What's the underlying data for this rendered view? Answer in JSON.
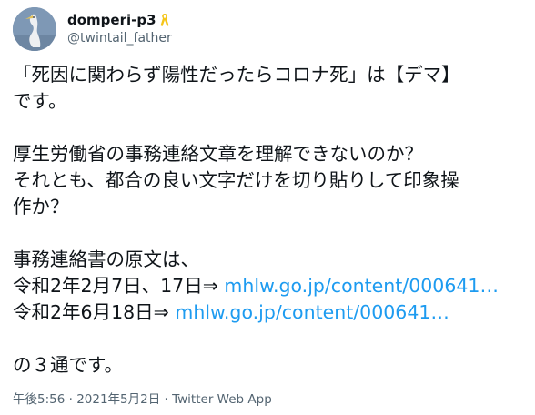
{
  "author": {
    "display_name": "domperi-p3",
    "handle": "@twintail_father",
    "badge_icon": "yellow-ribbon-icon"
  },
  "tweet": {
    "paragraph1": {
      "line1": "「死因に関わらず陽性だったらコロナ死」は【デマ】",
      "line2": "です。"
    },
    "paragraph2": {
      "line1": "厚生労働省の事務連絡文章を理解できないのか？",
      "line2": "それとも、都合の良い文字だけを切り貼りして印象操",
      "line3": "作か？"
    },
    "paragraph3": {
      "intro": "事務連絡書の原文は、",
      "item1_prefix": "令和2年2月7日、17日⇒ ",
      "item1_link": "mhlw.go.jp/content/000641…",
      "item2_prefix": "令和2年6月18日⇒ ",
      "item2_link": "mhlw.go.jp/content/000641…"
    },
    "closing": "の３通です。"
  },
  "meta": {
    "time": "午後5:56",
    "separator1": " · ",
    "date": "2021年5月2日",
    "separator2": " · ",
    "source": "Twitter Web App"
  },
  "colors": {
    "text": "#0f1419",
    "secondary": "#536471",
    "link": "#1d9bf0",
    "ribbon": "#f5c518"
  }
}
